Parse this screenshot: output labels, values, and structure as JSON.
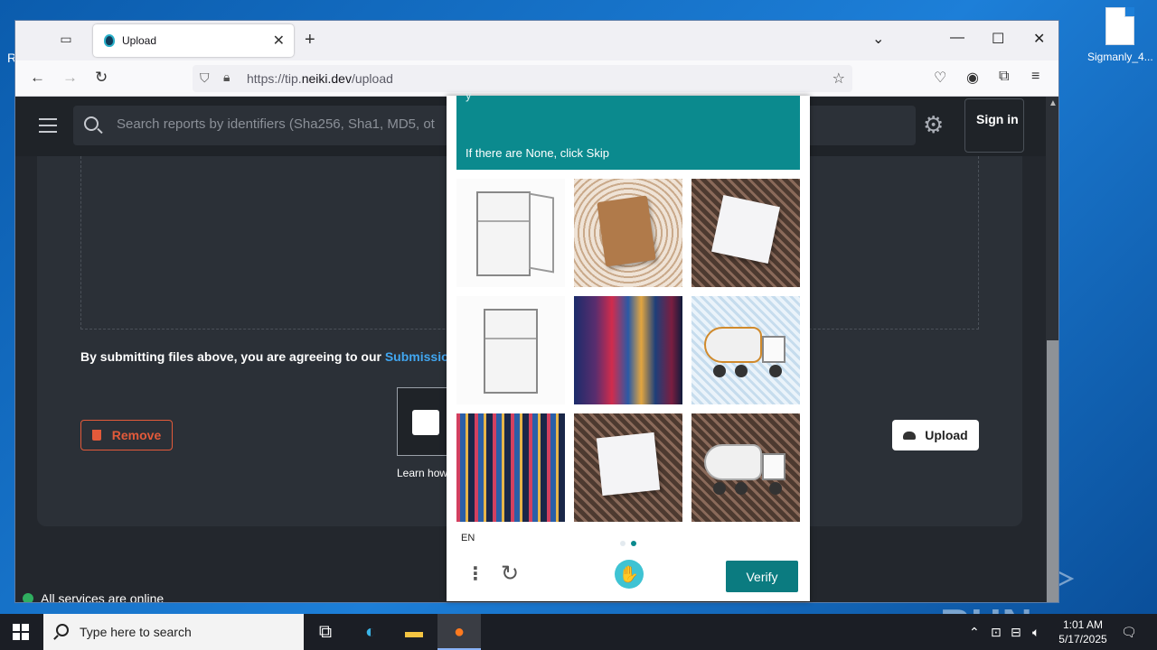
{
  "desktop": {
    "file_icon_label": "Sigmanly_4...",
    "watermark": "ANY ▷ RUN"
  },
  "browser": {
    "tab_title": "Upload",
    "url_prefix": "https://tip.",
    "url_domain": "neiki.dev",
    "url_path": "/upload"
  },
  "page": {
    "search_placeholder": "Search reports by identifiers (Sha256, Sha1, MD5, ot",
    "sign_in": "Sign in",
    "agree_text": "By submitting files above, you are agreeing to our ",
    "agree_link": "Submission",
    "remove_label": "Remove",
    "upload_label": "Upload",
    "learn_text": "Learn how",
    "status_text": "All services are online"
  },
  "captcha": {
    "header_cut_text": "y",
    "skip_text": "If there are None, click Skip",
    "images": [
      {
        "icon": "fridge-icon"
      },
      {
        "icon": "notebook-icon"
      },
      {
        "icon": "notebook-icon"
      },
      {
        "icon": "fridge-icon"
      },
      {
        "icon": "city-street-icon"
      },
      {
        "icon": "cement-truck-icon"
      },
      {
        "icon": "city-street-icon"
      },
      {
        "icon": "notebook-icon"
      },
      {
        "icon": "cement-truck-icon"
      }
    ],
    "language": "EN",
    "page_dots": 2,
    "active_dot": 2,
    "verify_label": "Verify",
    "accent_color": "#0b8a8e"
  },
  "taskbar": {
    "search_placeholder": "Type here to search",
    "time": "1:01 AM",
    "date": "5/17/2025"
  }
}
